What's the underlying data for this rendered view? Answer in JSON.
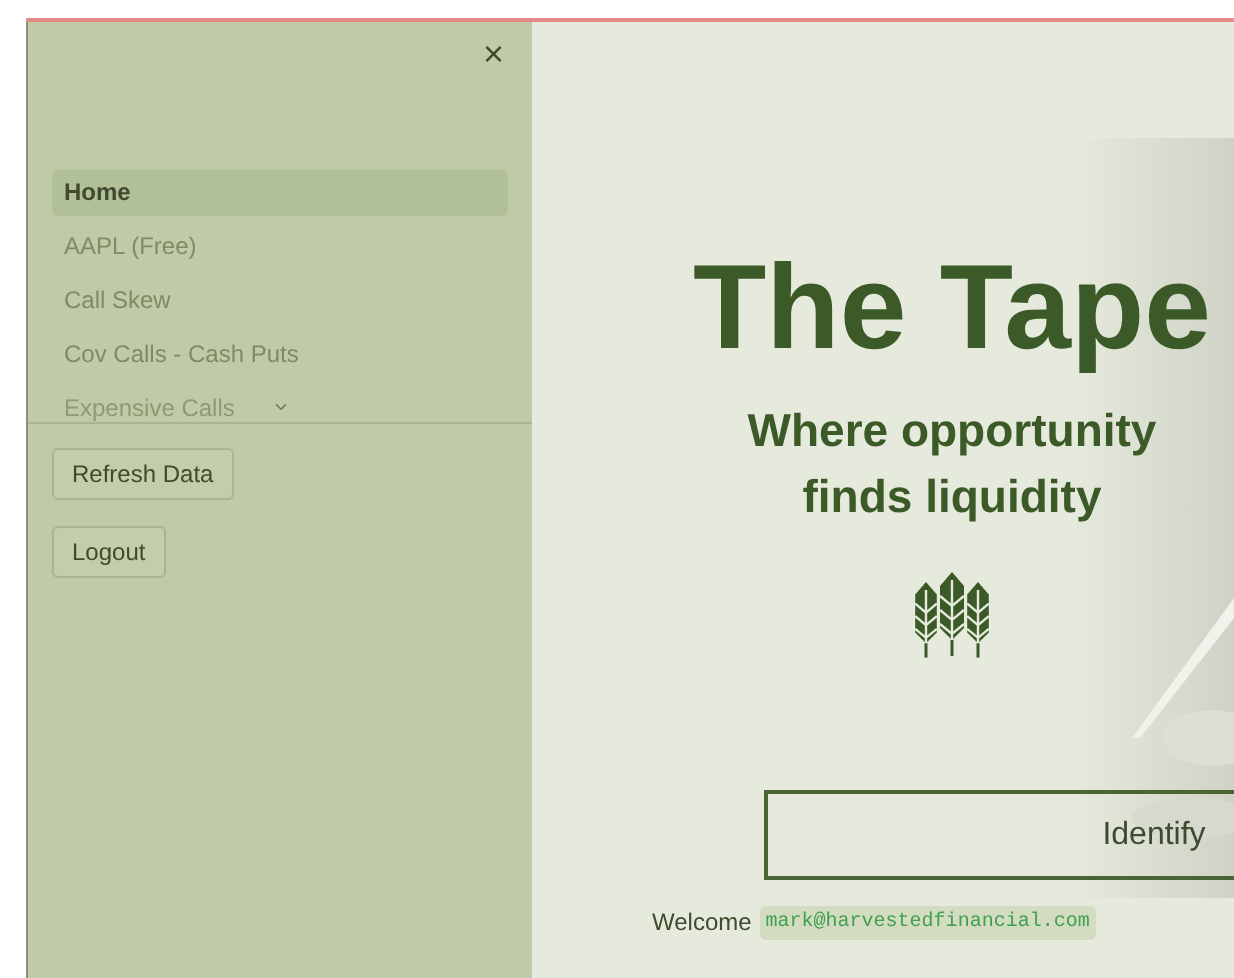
{
  "sidebar": {
    "close": "×",
    "nav": [
      {
        "label": "Home",
        "selected": true
      },
      {
        "label": "AAPL (Free)",
        "selected": false
      },
      {
        "label": "Call Skew",
        "selected": false
      },
      {
        "label": "Cov Calls - Cash Puts",
        "selected": false
      },
      {
        "label": "Expensive Calls",
        "selected": false
      }
    ],
    "buttons": [
      "Refresh Data",
      "Logout"
    ]
  },
  "main": {
    "title": "The Tape",
    "subtitle": "Where opportunity finds liquidity",
    "button": "Identify",
    "welcome": "Welcome",
    "email": "mark@harvestedfinancial.com"
  }
}
